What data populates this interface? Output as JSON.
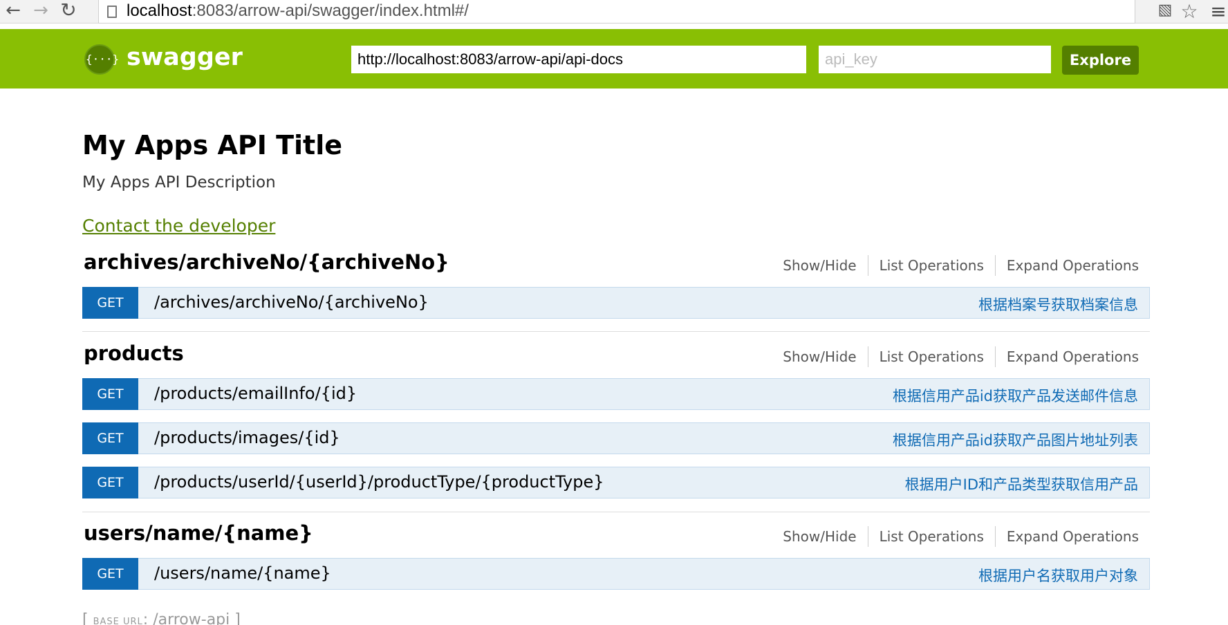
{
  "browser": {
    "url_host": "localhost",
    "url_rest": ":8083/arrow-api/swagger/index.html#/"
  },
  "header": {
    "logo_glyph": "{···}",
    "logo_text": "swagger",
    "api_url_value": "http://localhost:8083/arrow-api/api-docs",
    "api_key_placeholder": "api_key",
    "explore_label": "Explore"
  },
  "info": {
    "title": "My Apps API Title",
    "description": "My Apps API Description",
    "contact_label": "Contact the developer"
  },
  "resource_options": {
    "show_hide": "Show/Hide",
    "list_operations": "List Operations",
    "expand_operations": "Expand Operations"
  },
  "resources": [
    {
      "name": "archives/archiveNo/{archiveNo}",
      "operations": [
        {
          "method": "GET",
          "path": "/archives/archiveNo/{archiveNo}",
          "summary": "根据档案号获取档案信息"
        }
      ]
    },
    {
      "name": "products",
      "operations": [
        {
          "method": "GET",
          "path": "/products/emailInfo/{id}",
          "summary": "根据信用产品id获取产品发送邮件信息"
        },
        {
          "method": "GET",
          "path": "/products/images/{id}",
          "summary": "根据信用产品id获取产品图片地址列表"
        },
        {
          "method": "GET",
          "path": "/products/userId/{userId}/productType/{productType}",
          "summary": "根据用户ID和产品类型获取信用产品"
        }
      ]
    },
    {
      "name": "users/name/{name}",
      "operations": [
        {
          "method": "GET",
          "path": "/users/name/{name}",
          "summary": "根据用户名获取用户对象"
        }
      ]
    }
  ],
  "footer": {
    "base_url_label": "BASE URL",
    "base_url_value": "/arrow-api"
  },
  "colors": {
    "header_green": "#89bf04",
    "explore_button": "#547f00",
    "get_badge": "#0f6ab4",
    "operation_row": "#e7f0f7"
  }
}
